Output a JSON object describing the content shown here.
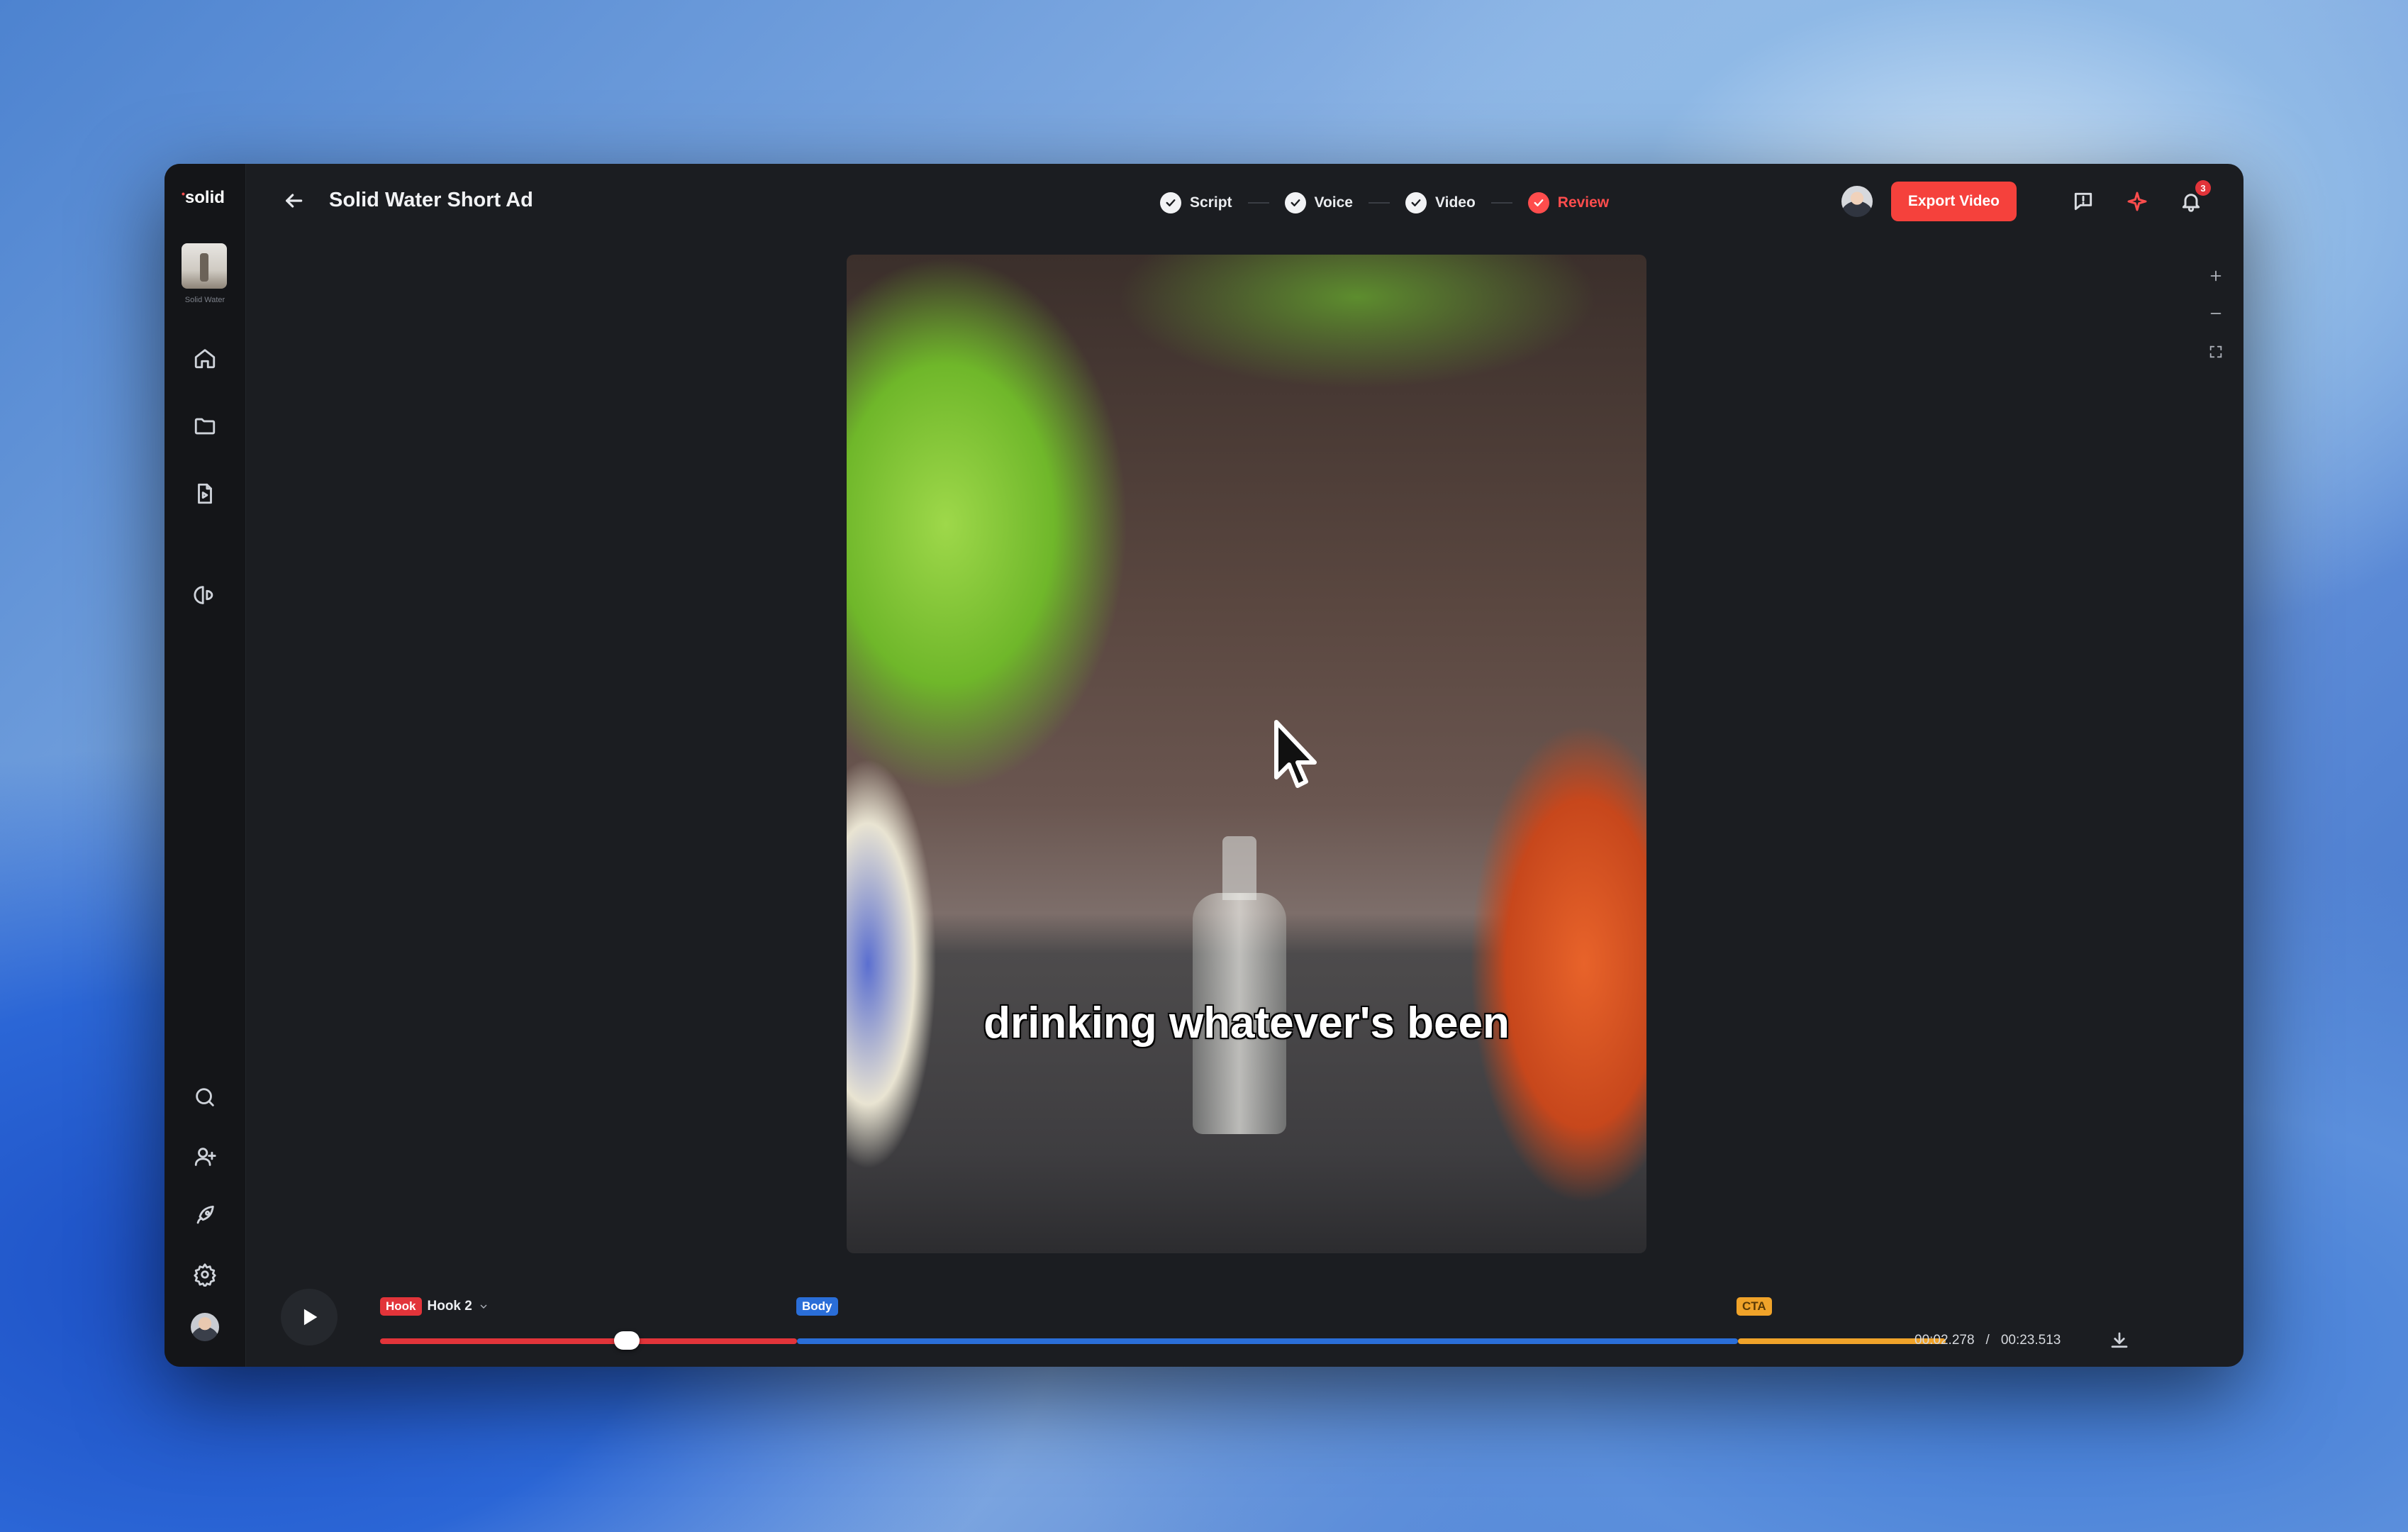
{
  "app": {
    "logo": "solid"
  },
  "project": {
    "name": "Solid Water",
    "title": "Solid Water Short Ad"
  },
  "steps": [
    {
      "label": "Script",
      "state": "done"
    },
    {
      "label": "Voice",
      "state": "done"
    },
    {
      "label": "Video",
      "state": "done"
    },
    {
      "label": "Review",
      "state": "active"
    }
  ],
  "header": {
    "export_label": "Export Video",
    "notification_count": "3"
  },
  "video": {
    "caption": "drinking whatever's been"
  },
  "timeline": {
    "hook_tag": "Hook",
    "hook_variant": "Hook 2",
    "body_tag": "Body",
    "cta_tag": "CTA",
    "current_time": "00:02.278",
    "time_separator": "/",
    "total_time": "00:23.513",
    "progress": 0.097
  },
  "colors": {
    "accent": "#f5413c",
    "hook": "#e2343a",
    "body": "#2a6ed8",
    "cta": "#f0a32a",
    "background": "#1b1d21"
  },
  "icons": {
    "sidebar_top": [
      "home-icon",
      "folder-icon",
      "document-video-icon",
      "brand-icon"
    ],
    "sidebar_bottom": [
      "search-icon",
      "add-user-icon",
      "rocket-icon",
      "settings-icon"
    ],
    "header": [
      "back-arrow-icon",
      "feedback-icon",
      "sparkle-icon",
      "bell-icon"
    ],
    "zoom": [
      "plus-icon",
      "minus-icon",
      "fullscreen-icon"
    ]
  }
}
